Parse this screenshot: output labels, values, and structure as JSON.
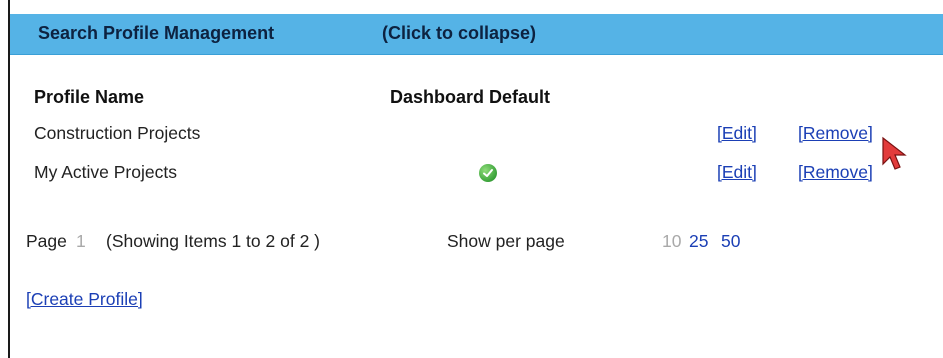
{
  "panel": {
    "title": "Search Profile Management",
    "collapse_label": "(Click to collapse)",
    "accent_color": "#55b3e6"
  },
  "table": {
    "headers": {
      "name": "Profile Name",
      "default": "Dashboard Default"
    },
    "rows": [
      {
        "name": "Construction Projects",
        "is_default": false,
        "edit": "[Edit]",
        "remove": "[Remove]"
      },
      {
        "name": "My Active Projects",
        "is_default": true,
        "edit": "[Edit]",
        "remove": "[Remove]"
      }
    ],
    "default_icon": "check-circle-icon"
  },
  "pagination": {
    "page_label": "Page",
    "page_number": "1",
    "showing_text": "(Showing Items 1 to 2 of 2 )",
    "per_page_label": "Show per page",
    "per_page_options": [
      "10",
      "25",
      "50"
    ],
    "selected_per_page": "10"
  },
  "actions": {
    "create_profile": "[Create Profile]"
  }
}
